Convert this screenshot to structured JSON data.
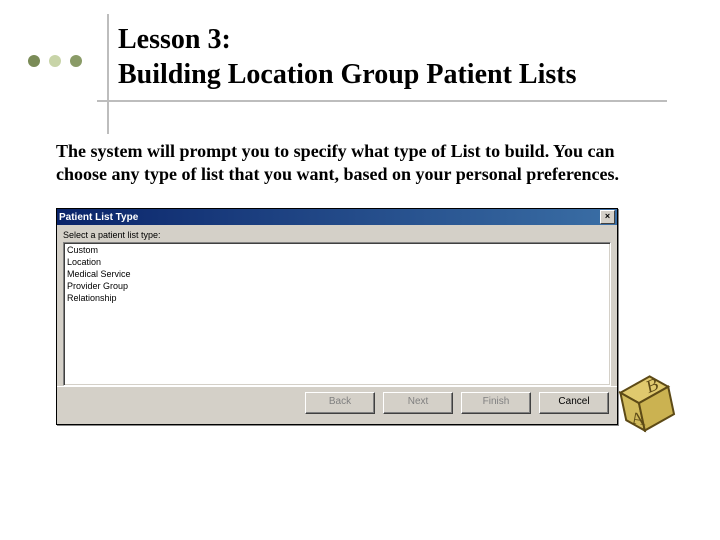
{
  "title_line1": "Lesson 3:",
  "title_line2": "Building Location Group Patient Lists",
  "body_text": "The system will prompt you to specify what type of List to build. You can choose any type of list that you want, based on your personal preferences.",
  "dialog": {
    "title": "Patient List Type",
    "close": "×",
    "prompt": "Select a patient list type:",
    "options": [
      "Custom",
      "Location",
      "Medical Service",
      "Provider Group",
      "Relationship"
    ],
    "buttons": {
      "back": "Back",
      "next": "Next",
      "finish": "Finish",
      "cancel": "Cancel"
    }
  }
}
